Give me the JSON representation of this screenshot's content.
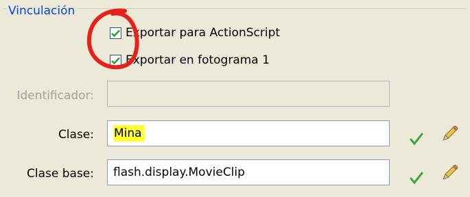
{
  "section": {
    "legend": "Vinculación"
  },
  "checkboxes": [
    {
      "label": "Exportar para ActionScript",
      "checked": true
    },
    {
      "label": "Exportar en fotograma 1",
      "checked": true
    }
  ],
  "fields": {
    "identificador": {
      "label": "Identificador:",
      "value": "",
      "enabled": false
    },
    "clase": {
      "label": "Clase:",
      "value": "Mina"
    },
    "clase_base": {
      "label": "Clase base:",
      "value": "flash.display.MovieClip"
    }
  },
  "icons": {
    "validate": "checkmark-icon",
    "edit": "pencil-icon"
  },
  "colors": {
    "legend": "#0046d5",
    "highlight": "#ffff33",
    "annotation": "#e8201a",
    "validate": "#3aa53a"
  }
}
